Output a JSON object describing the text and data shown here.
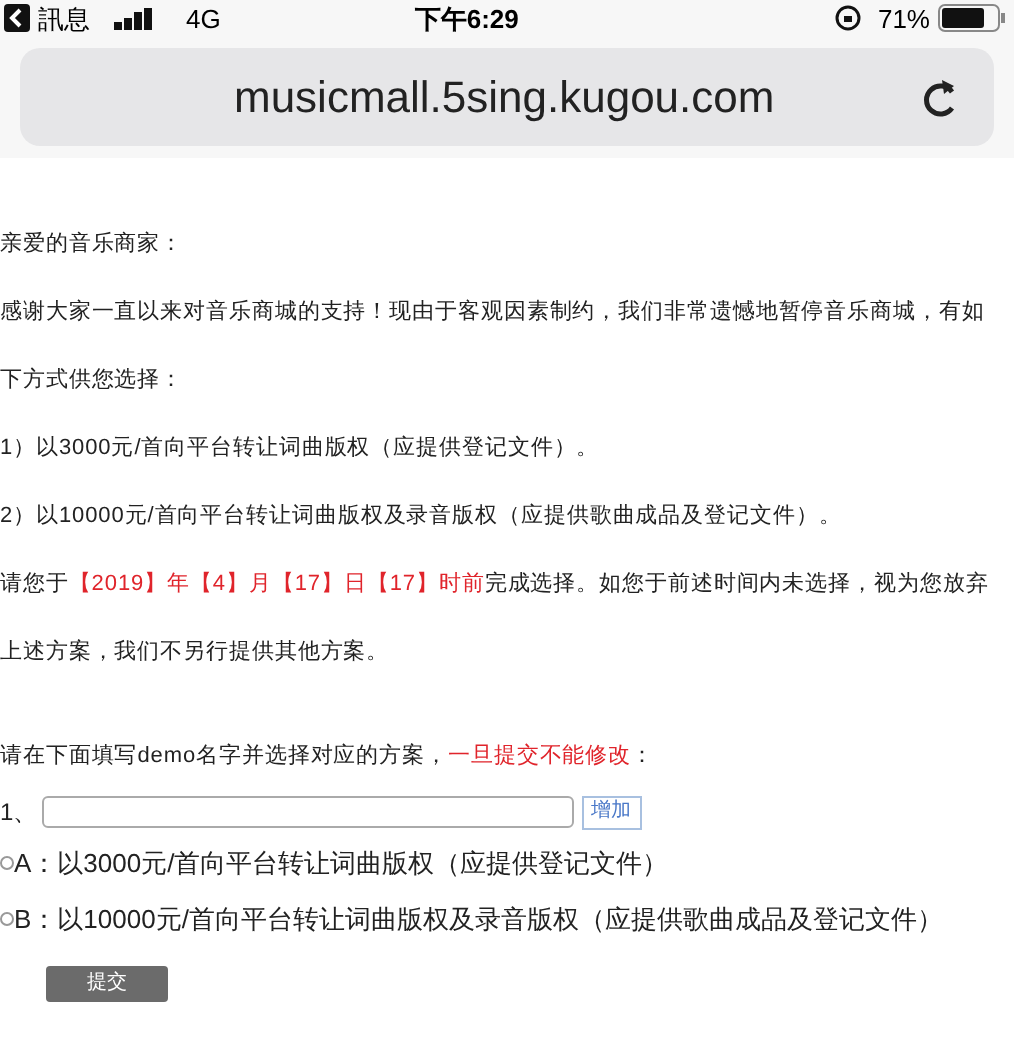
{
  "status_bar": {
    "back_app": "訊息",
    "network": "4G",
    "time": "下午6:29",
    "battery": "71%"
  },
  "address_bar": {
    "url": "musicmall.5sing.kugou.com"
  },
  "notice": [
    [
      {
        "text": "亲爱的音乐商家：",
        "kind": "plain"
      }
    ],
    [
      {
        "text": "感谢大家一直以来对音乐商城的支持！现由于客观因素制约，我们非常遗憾地暂停音乐商城，有如",
        "kind": "plain"
      }
    ],
    [
      {
        "text": "下方式供您选择：",
        "kind": "plain"
      }
    ],
    [
      {
        "text": "1）以3000元/首向平台转让词曲版权（应提供登记文件）。",
        "kind": "plain"
      }
    ],
    [
      {
        "text": "2）以10000元/首向平台转让词曲版权及录音版权（应提供歌曲成品及登记文件）。",
        "kind": "plain"
      }
    ],
    [
      {
        "text": "请您于",
        "kind": "plain"
      },
      {
        "text": "【2019】年【4】月【17】日【17】时前",
        "kind": "highlight"
      },
      {
        "text": "完成选择。如您于前述时间内未选择，视为您放弃",
        "kind": "plain"
      }
    ],
    [
      {
        "text": "上述方案，我们不另行提供其他方案。",
        "kind": "plain"
      }
    ]
  ],
  "instruction": [
    {
      "text": "请在下面填写demo名字并选择对应的方案，",
      "kind": "plain"
    },
    {
      "text": "一旦提交不能修改",
      "kind": "highlight"
    },
    {
      "text": "：",
      "kind": "plain"
    }
  ],
  "demo_row": {
    "label": "1、",
    "add_button": "增加"
  },
  "options": [
    {
      "label": "A：以3000元/首向平台转让词曲版权（应提供登记文件）",
      "selected": false
    },
    {
      "label": "B：以10000元/首向平台转让词曲版权及录音版权（应提供歌曲成品及登记文件）",
      "selected": false
    }
  ],
  "submit_button": "提交"
}
